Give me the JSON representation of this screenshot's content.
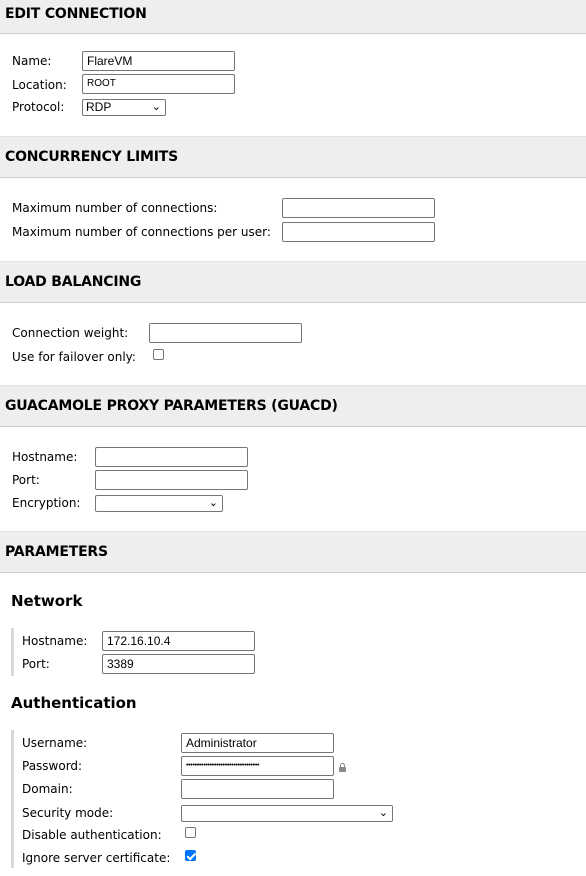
{
  "edit_connection": {
    "title": "EDIT CONNECTION",
    "name_label": "Name:",
    "name_value": "FlareVM",
    "location_label": "Location:",
    "location_value": "ROOT",
    "protocol_label": "Protocol:",
    "protocol_value": "RDP"
  },
  "concurrency": {
    "title": "CONCURRENCY LIMITS",
    "max_conn_label": "Maximum number of connections:",
    "max_conn_value": "",
    "max_conn_user_label": "Maximum number of connections per user:",
    "max_conn_user_value": ""
  },
  "load_balancing": {
    "title": "LOAD BALANCING",
    "weight_label": "Connection weight:",
    "weight_value": "",
    "failover_label": "Use for failover only:",
    "failover_checked": false
  },
  "guacd": {
    "title": "GUACAMOLE PROXY PARAMETERS (GUACD)",
    "hostname_label": "Hostname:",
    "hostname_value": "",
    "port_label": "Port:",
    "port_value": "",
    "encryption_label": "Encryption:",
    "encryption_value": ""
  },
  "parameters": {
    "title": "PARAMETERS",
    "network": {
      "title": "Network",
      "hostname_label": "Hostname:",
      "hostname_value": "172.16.10.4",
      "port_label": "Port:",
      "port_value": "3389"
    },
    "authentication": {
      "title": "Authentication",
      "username_label": "Username:",
      "username_value": "Administrator",
      "password_label": "Password:",
      "password_value": "••••••••••••••••••••••••••••••••••",
      "domain_label": "Domain:",
      "domain_value": "",
      "security_mode_label": "Security mode:",
      "security_mode_value": "",
      "disable_auth_label": "Disable authentication:",
      "disable_auth_checked": false,
      "ignore_cert_label": "Ignore server certificate:",
      "ignore_cert_checked": true
    }
  }
}
